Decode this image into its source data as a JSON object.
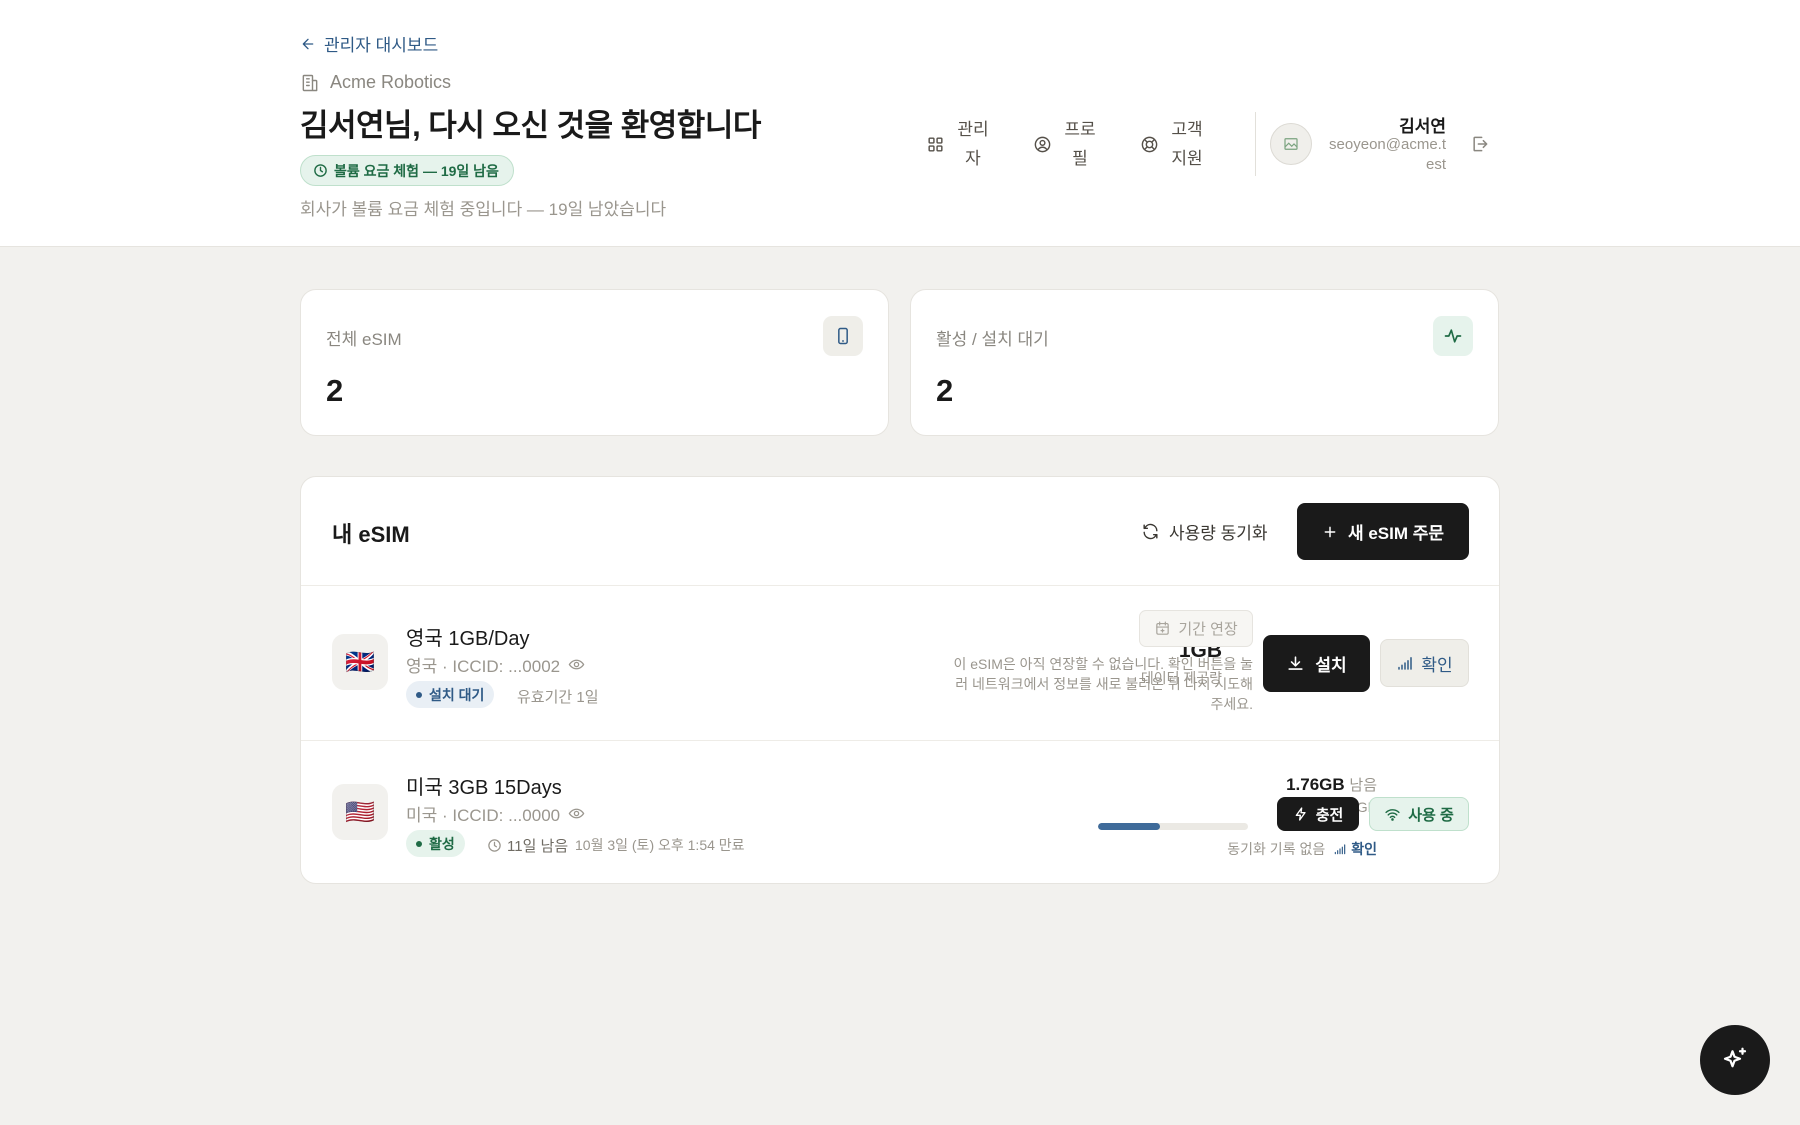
{
  "header": {
    "back_label": "관리자 대시보드",
    "company": "Acme Robotics",
    "welcome": "김서연님, 다시 오신 것을 환영합니다",
    "trial_badge": "볼륨 요금 체험 — 19일 남음",
    "trial_text": "회사가 볼륨 요금 체험 중입니다 — 19일 남았습니다",
    "nav": [
      {
        "label_1": "관리",
        "label_2": "자",
        "icon": "grid-icon"
      },
      {
        "label_1": "프로",
        "label_2": "필",
        "icon": "user-circle-icon"
      },
      {
        "label_1": "고객",
        "label_2": "지원",
        "icon": "lifebuoy-icon"
      }
    ],
    "user": {
      "name": "김서연",
      "email": "seoyeon@acme.test"
    }
  },
  "stats": [
    {
      "label": "전체 eSIM",
      "value": "2",
      "icon": "phone-icon",
      "icon_bg": "#efeee9"
    },
    {
      "label": "활성 / 설치 대기",
      "value": "2",
      "icon": "activity-icon",
      "icon_bg": "#e6f3ec"
    }
  ],
  "esims": {
    "title": "내 eSIM",
    "sync_label": "사용량 동기화",
    "order_label": "새 eSIM 주문",
    "items": [
      {
        "flag": "🇬🇧",
        "name": "영국 1GB/Day",
        "meta": "영국 · ICCID: ...0002",
        "status": "설치 대기",
        "validity": "유효기간 1일",
        "data_amount": "1GB",
        "data_caption": "데이터 제공량",
        "extend_label": "기간 연장",
        "extend_note": "이 eSIM은 아직 연장할 수 없습니다. 확인 버튼을 눌러 네트워크에서 정보를 새로 불러온 뒤 다시 시도해 주세요.",
        "install_label": "설치",
        "check_label": "확인"
      },
      {
        "flag": "🇺🇸",
        "name": "미국 3GB 15Days",
        "meta": "미국 · ICCID: ...0000",
        "status": "활성",
        "days_left": "11일 남음",
        "expiry": "10월 3일 (토) 오후 1:54 만료",
        "remaining_amount": "1.76GB",
        "remaining_suffix": "남음",
        "total": "총 3GB",
        "usage_fraction": 0.41,
        "sync_status": "동기화 기록 없음",
        "check_label": "확인",
        "charge_label": "충전",
        "inuse_label": "사용 중"
      }
    ]
  },
  "colors": {
    "accent_green": "#1f6b45",
    "accent_blue": "#2f5a86",
    "dark": "#1a1a1a"
  }
}
